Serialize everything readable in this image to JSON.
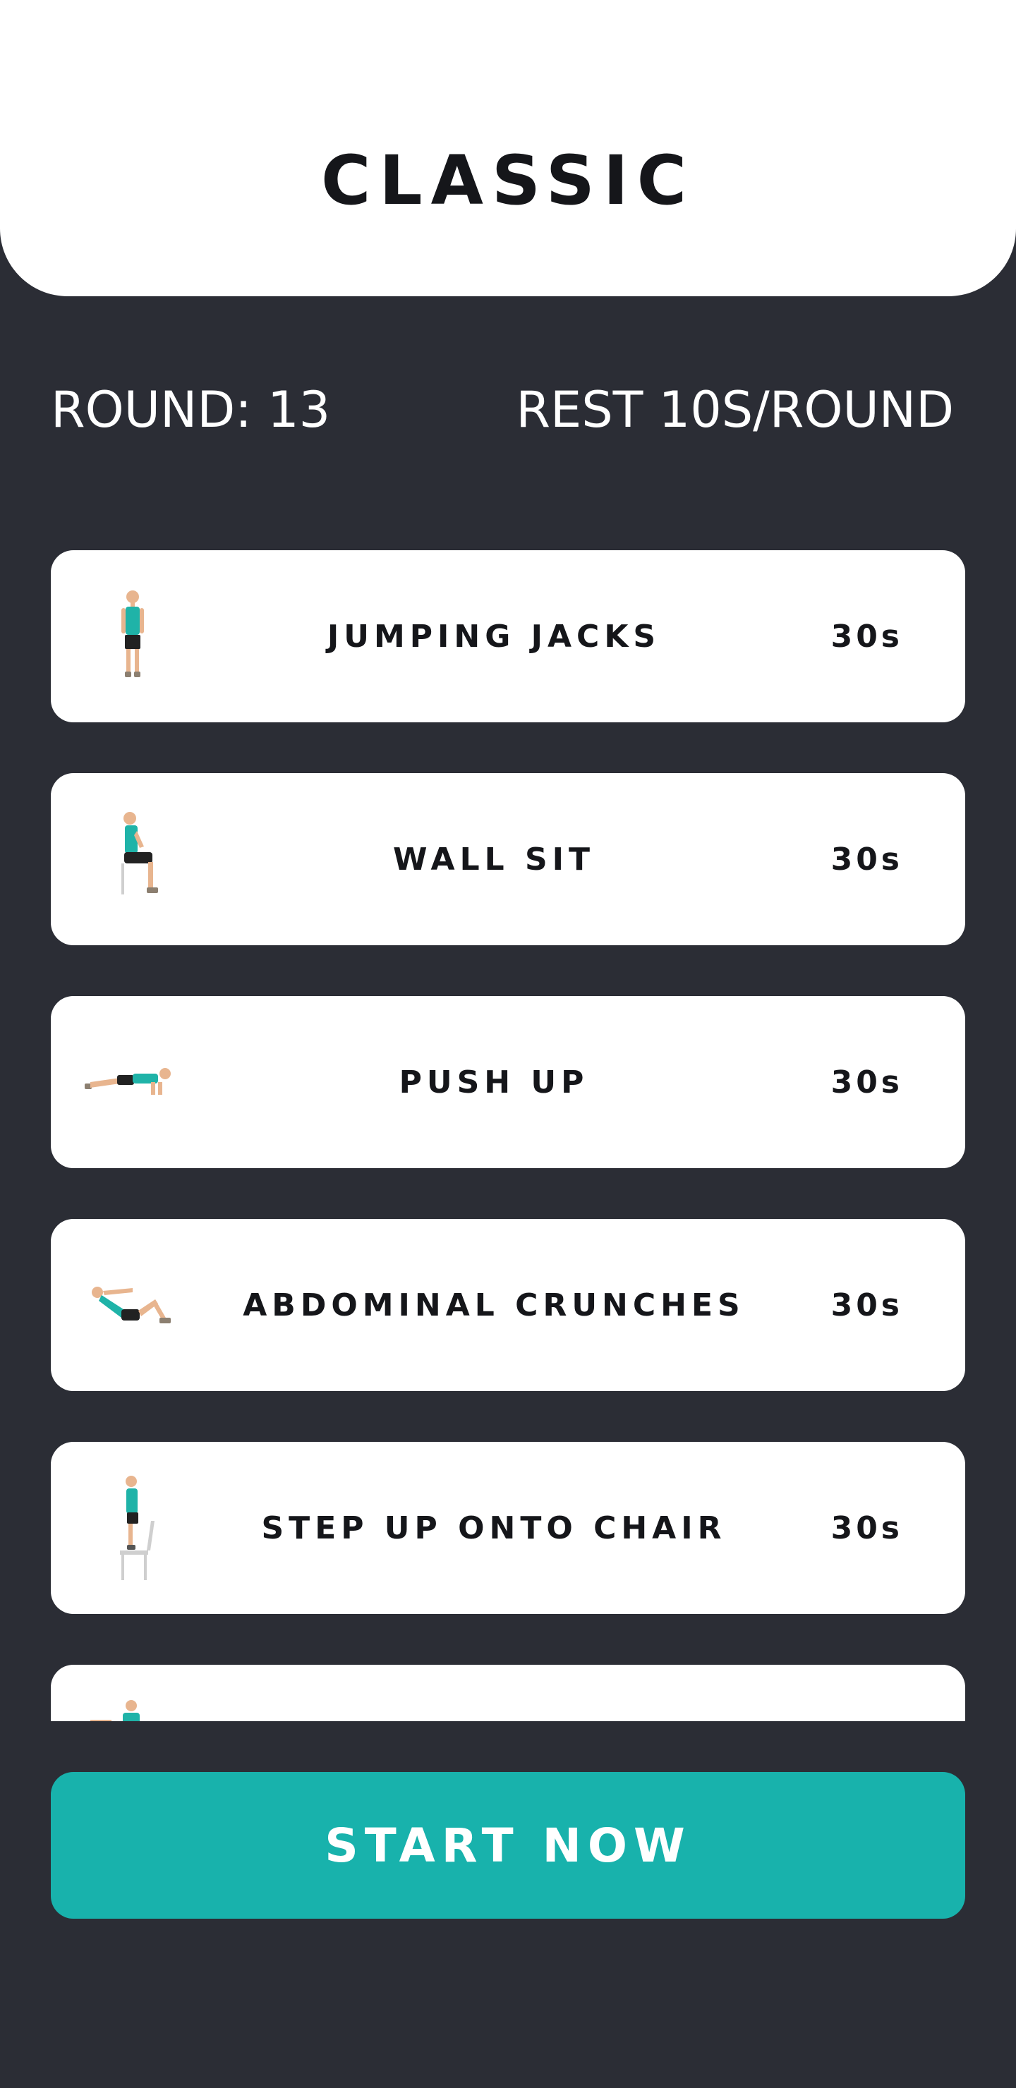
{
  "header": {
    "title": "CLASSIC"
  },
  "info": {
    "round": "ROUND: 13",
    "rest": "REST 10S/ROUND"
  },
  "exercises": [
    {
      "name": "JUMPING JACKS",
      "duration": "30s",
      "icon": "jumping-jacks-figure"
    },
    {
      "name": "WALL SIT",
      "duration": "30s",
      "icon": "wall-sit-figure"
    },
    {
      "name": "PUSH UP",
      "duration": "30s",
      "icon": "push-up-figure"
    },
    {
      "name": "ABDOMINAL CRUNCHES",
      "duration": "30s",
      "icon": "abdominal-crunch-figure"
    },
    {
      "name": "STEP UP ONTO CHAIR",
      "duration": "30s",
      "icon": "step-up-chair-figure"
    },
    {
      "name": "",
      "duration": "",
      "icon": "next-exercise-figure"
    }
  ],
  "start_button": {
    "label": "START NOW"
  },
  "colors": {
    "background": "#2b2d35",
    "card": "#ffffff",
    "accent": "#18b2ac",
    "figure_shirt": "#1fb3a8",
    "figure_shorts": "#222222",
    "figure_skin": "#e8b58f"
  }
}
